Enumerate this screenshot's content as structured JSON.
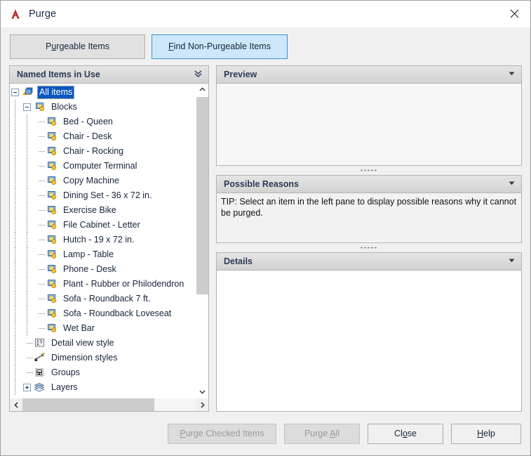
{
  "window": {
    "title": "Purge",
    "logo_icon": "autocad-a-logo",
    "close_icon": "close-icon"
  },
  "tabs": [
    {
      "label": "Purgeable Items",
      "mnemonic": "u",
      "active": false
    },
    {
      "label": "Find Non-Purgeable Items",
      "mnemonic": "F",
      "active": true
    }
  ],
  "left_panel": {
    "header": "Named Items in Use",
    "collapse_icon": "double-chevron-down-icon",
    "tree": [
      {
        "label": "All items",
        "depth": 0,
        "icon": "drawing-icon",
        "expander": "minus",
        "selected": true
      },
      {
        "label": "Blocks",
        "depth": 1,
        "icon": "block-icon",
        "expander": "minus",
        "selected": false
      },
      {
        "label": "Bed - Queen",
        "depth": 2,
        "icon": "block-icon",
        "expander": "none",
        "selected": false
      },
      {
        "label": "Chair - Desk",
        "depth": 2,
        "icon": "block-icon",
        "expander": "none",
        "selected": false
      },
      {
        "label": "Chair - Rocking",
        "depth": 2,
        "icon": "block-icon",
        "expander": "none",
        "selected": false
      },
      {
        "label": "Computer Terminal",
        "depth": 2,
        "icon": "block-icon",
        "expander": "none",
        "selected": false
      },
      {
        "label": "Copy Machine",
        "depth": 2,
        "icon": "block-icon",
        "expander": "none",
        "selected": false
      },
      {
        "label": "Dining Set - 36 x 72 in.",
        "depth": 2,
        "icon": "block-icon",
        "expander": "none",
        "selected": false
      },
      {
        "label": "Exercise Bike",
        "depth": 2,
        "icon": "block-icon",
        "expander": "none",
        "selected": false
      },
      {
        "label": "File Cabinet - Letter",
        "depth": 2,
        "icon": "block-icon",
        "expander": "none",
        "selected": false
      },
      {
        "label": "Hutch - 19 x 72 in.",
        "depth": 2,
        "icon": "block-icon",
        "expander": "none",
        "selected": false
      },
      {
        "label": "Lamp - Table",
        "depth": 2,
        "icon": "block-icon",
        "expander": "none",
        "selected": false
      },
      {
        "label": "Phone - Desk",
        "depth": 2,
        "icon": "block-icon",
        "expander": "none",
        "selected": false
      },
      {
        "label": "Plant - Rubber or Philodendron",
        "depth": 2,
        "icon": "block-icon",
        "expander": "none",
        "selected": false
      },
      {
        "label": "Sofa - Roundback 7 ft.",
        "depth": 2,
        "icon": "block-icon",
        "expander": "none",
        "selected": false
      },
      {
        "label": "Sofa - Roundback Loveseat",
        "depth": 2,
        "icon": "block-icon",
        "expander": "none",
        "selected": false
      },
      {
        "label": "Wet Bar",
        "depth": 2,
        "icon": "block-icon",
        "expander": "none",
        "selected": false
      },
      {
        "label": "Detail view style",
        "depth": 1,
        "icon": "detail-view-style-icon",
        "expander": "none",
        "selected": false
      },
      {
        "label": "Dimension styles",
        "depth": 1,
        "icon": "dimension-style-icon",
        "expander": "none",
        "selected": false
      },
      {
        "label": "Groups",
        "depth": 1,
        "icon": "groups-icon",
        "expander": "none",
        "selected": false
      },
      {
        "label": "Layers",
        "depth": 1,
        "icon": "layers-icon",
        "expander": "plus",
        "selected": false
      }
    ],
    "scrollbars": {
      "vertical_up_icon": "chevron-up-icon",
      "vertical_down_icon": "chevron-down-icon",
      "horizontal_left_icon": "chevron-left-icon",
      "horizontal_right_icon": "chevron-right-icon"
    }
  },
  "right_panel": {
    "preview": {
      "header": "Preview",
      "collapse_icon": "chevron-down-icon",
      "content": ""
    },
    "possible_reasons": {
      "header": "Possible Reasons",
      "collapse_icon": "chevron-down-icon",
      "content": "TIP: Select an item in the left pane to display possible reasons why it cannot be purged."
    },
    "details": {
      "header": "Details",
      "collapse_icon": "chevron-down-icon",
      "content": ""
    }
  },
  "footer": {
    "buttons": [
      {
        "label": "Purge Checked Items",
        "mnemonic": "P",
        "enabled": false
      },
      {
        "label": "Purge All",
        "mnemonic": "A",
        "enabled": false
      },
      {
        "label": "Close",
        "mnemonic": "o",
        "enabled": true
      },
      {
        "label": "Help",
        "mnemonic": "H",
        "enabled": true
      }
    ]
  },
  "colors": {
    "selection_blue": "#0a57c2",
    "active_tab_fill": "#cde8fa",
    "active_tab_border": "#3c91d4",
    "logo_red": "#b82020",
    "dialog_bg": "#f0f0f0"
  }
}
